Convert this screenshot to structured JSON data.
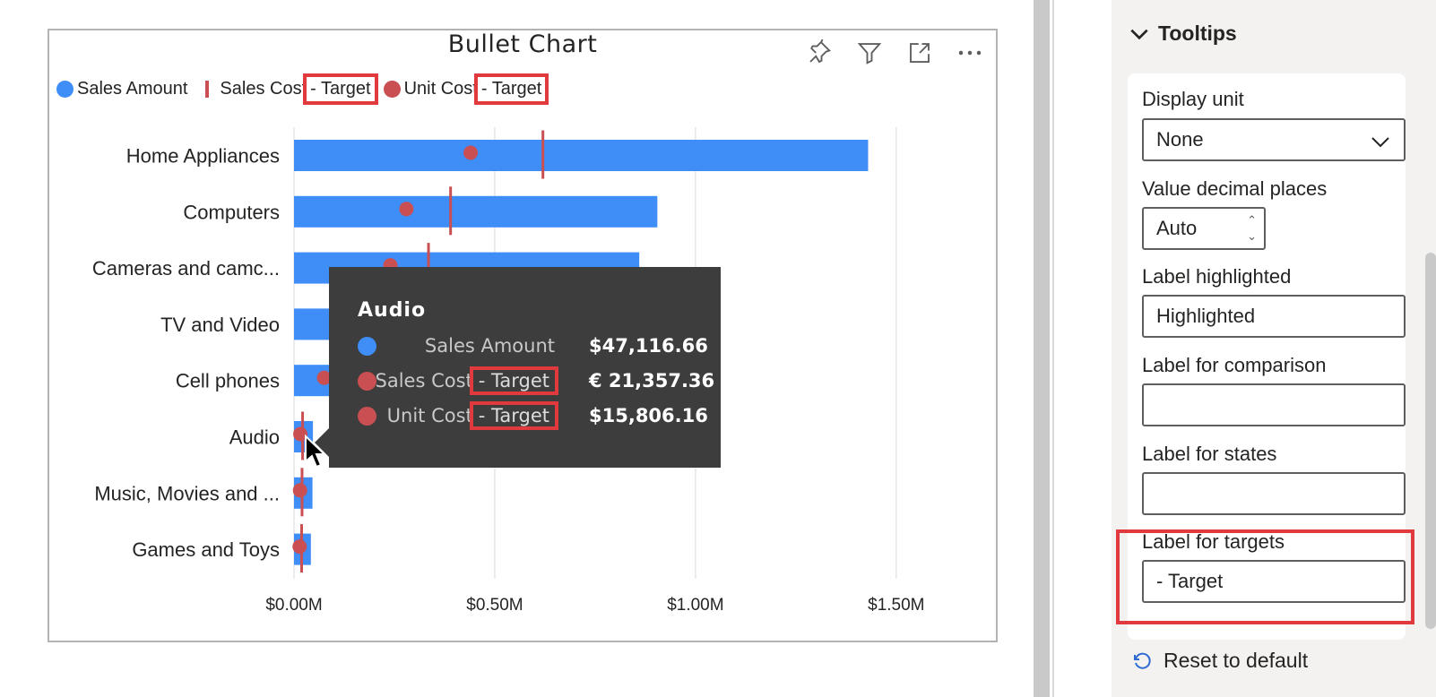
{
  "visual": {
    "title": "Bullet Chart",
    "toolbar": {
      "pin_icon": "pin-icon",
      "filter_icon": "filter-icon",
      "focus_icon": "focus-mode-icon",
      "more_icon": "more-options-icon"
    }
  },
  "legend": {
    "items": [
      {
        "name": "Sales Amount",
        "marker": "dot",
        "color": "#3f8df6"
      },
      {
        "name": "Sales Cost",
        "suffix": "- Target",
        "marker": "line",
        "color": "#c94f52"
      },
      {
        "name": "Unit Cost",
        "suffix": "- Target",
        "marker": "dot",
        "color": "#c94f52"
      }
    ]
  },
  "chart_data": {
    "type": "bar",
    "orientation": "horizontal",
    "title": "Bullet Chart",
    "categories": [
      "Home Appliances",
      "Computers",
      "Cameras and camc...",
      "TV and Video",
      "Cell phones",
      "Audio",
      "Music, Movies and ...",
      "Games and Toys"
    ],
    "series": [
      {
        "name": "Sales Amount",
        "kind": "bar",
        "color": "#3f8df6",
        "values": [
          1430000,
          905000,
          860000,
          650000,
          115000,
          47116.66,
          46000,
          42000
        ]
      },
      {
        "name": "Sales Cost - Target",
        "kind": "target-line",
        "color": "#c94f52",
        "values": [
          620000,
          390000,
          335000,
          300000,
          105000,
          21357.36,
          20000,
          19000
        ]
      },
      {
        "name": "Unit Cost - Target",
        "kind": "dot",
        "color": "#c94f52",
        "values": [
          440000,
          280000,
          240000,
          200000,
          75000,
          15806.16,
          15000,
          14000
        ]
      }
    ],
    "xlim": [
      0,
      1650000
    ],
    "x_ticks": [
      0,
      500000,
      1000000,
      1500000
    ],
    "x_tick_labels": [
      "$0.00M",
      "$0.50M",
      "$1.00M",
      "$1.50M"
    ],
    "grid": true,
    "legend_position": "top-left"
  },
  "tooltip": {
    "title": "Audio",
    "rows": [
      {
        "label": "Sales Amount",
        "suffix": "",
        "value": "$47,116.66",
        "color": "#3f8df6"
      },
      {
        "label": "Sales Cost",
        "suffix": "- Target",
        "value": "€ 21,357.36",
        "color": "#c94f52"
      },
      {
        "label": "Unit Cost",
        "suffix": "- Target",
        "value": "$15,806.16",
        "color": "#c94f52"
      }
    ]
  },
  "pane": {
    "section_title": "Tooltips",
    "display_unit": {
      "label": "Display unit",
      "value": "None"
    },
    "decimal_places": {
      "label": "Value decimal places",
      "value": "Auto"
    },
    "label_highlighted": {
      "label": "Label highlighted",
      "value": "Highlighted"
    },
    "label_comparison": {
      "label": "Label for comparison",
      "value": ""
    },
    "label_states": {
      "label": "Label for states",
      "value": ""
    },
    "label_targets": {
      "label": "Label for targets",
      "value": "- Target"
    },
    "reset_label": "Reset to default"
  }
}
